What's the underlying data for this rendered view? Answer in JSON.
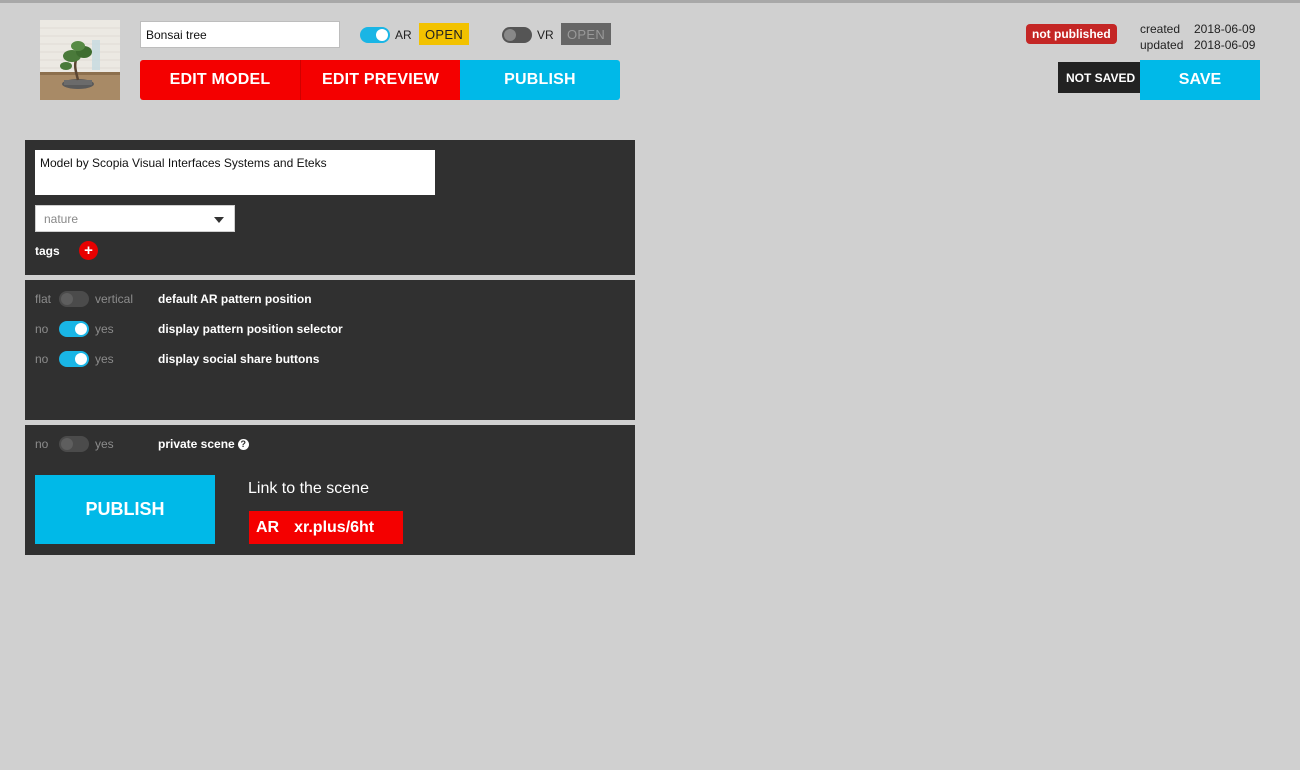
{
  "header": {
    "model_name": "Bonsai tree",
    "ar_label": "AR",
    "ar_open": "OPEN",
    "vr_label": "VR",
    "vr_open": "OPEN",
    "ar_enabled": true,
    "vr_enabled": false
  },
  "tabs": [
    {
      "label": "EDIT MODEL",
      "color": "#f40000"
    },
    {
      "label": "EDIT PREVIEW",
      "color": "#f40000"
    },
    {
      "label": "PUBLISH",
      "color": "#00b9e8",
      "active": true
    }
  ],
  "status": {
    "published_badge": "not published",
    "created_label": "created",
    "created_value": "2018-06-09",
    "updated_label": "updated",
    "updated_value": "2018-06-09",
    "not_saved": "NOT SAVED",
    "save_label": "SAVE"
  },
  "info_panel": {
    "description": "Model by Scopia Visual Interfaces Systems and Eteks",
    "category": "nature",
    "tags_label": "tags",
    "add_tag_symbol": "+"
  },
  "options": [
    {
      "left": "flat",
      "right": "vertical",
      "label": "default AR pattern position",
      "on": false
    },
    {
      "left": "no",
      "right": "yes",
      "label": "display pattern position selector",
      "on": true
    },
    {
      "left": "no",
      "right": "yes",
      "label": "display social share buttons",
      "on": true
    }
  ],
  "privacy": {
    "left": "no",
    "right": "yes",
    "label": "private scene",
    "on": false,
    "help_symbol": "?"
  },
  "publish_panel": {
    "publish_label": "PUBLISH",
    "link_title": "Link to the scene",
    "link_type": "AR",
    "link_url": "xr.plus/6ht"
  },
  "colors": {
    "accent_blue": "#00b9e8",
    "accent_red": "#f40000",
    "ar_yellow": "#f2c200",
    "panel_bg": "#303030",
    "page_bg": "#d0d0d0"
  }
}
